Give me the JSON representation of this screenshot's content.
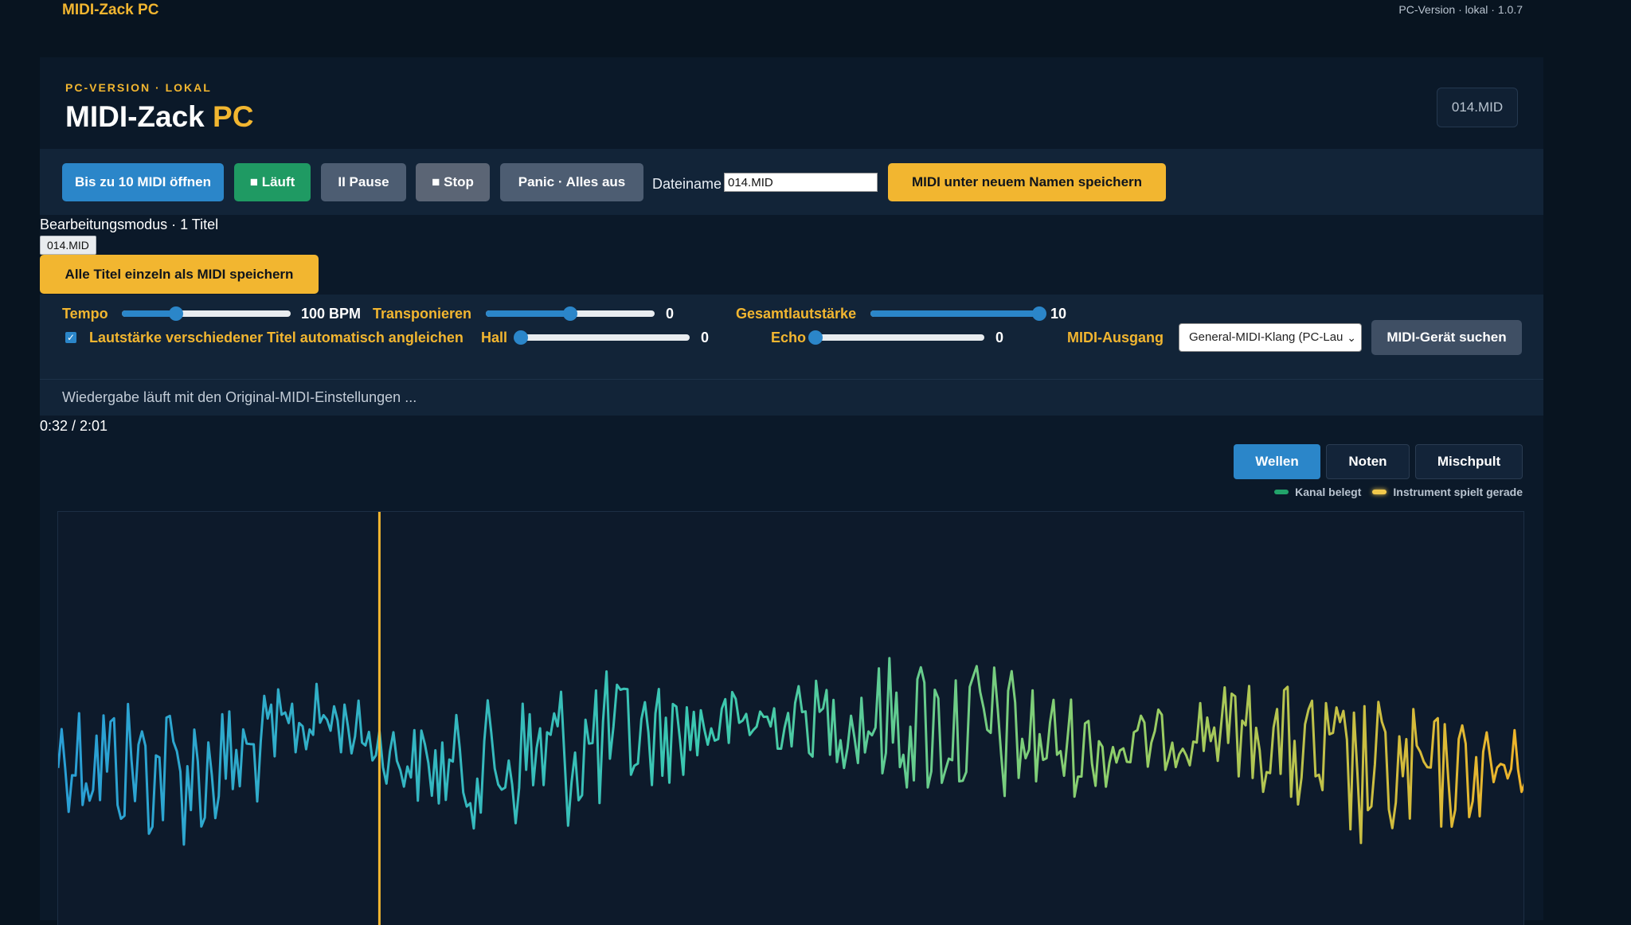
{
  "topbar": {
    "brand": "MIDI-Zack PC",
    "meta": "PC-Version · lokal · 1.0.7"
  },
  "header": {
    "kicker": "PC-VERSION · LOKAL",
    "title_main": "MIDI-Zack ",
    "title_accent": "PC",
    "file_badge": "014.MID"
  },
  "toolbar": {
    "open_label": "Bis zu 10 MIDI öffnen",
    "play_label": "■ Läuft",
    "pause_label": "II Pause",
    "stop_label": "■ Stop",
    "panic_label": "Panic · Alles aus",
    "filename_label": "Dateiname",
    "filename_value": "014.MID",
    "save_as_label": "MIDI unter neuem Namen speichern"
  },
  "edit": {
    "mode_text": "Bearbeitungsmodus · 1 Titel",
    "file_tag": "014.MID",
    "save_all_label": "Alle Titel einzeln als MIDI speichern"
  },
  "controls": {
    "tempo_label": "Tempo",
    "tempo_value": "100 BPM",
    "tempo_level": 0.32,
    "transpose_label": "Transponieren",
    "transpose_value": "0",
    "transpose_level": 0.5,
    "volume_label": "Gesamtlautstärke",
    "volume_value": "10",
    "volume_level": 1.0,
    "auto_level_checked": true,
    "auto_level_label": "Lautstärke verschiedener Titel automatisch angleichen",
    "reverb_label": "Hall",
    "reverb_value": "0",
    "reverb_level": 0.0,
    "echo_label": "Echo",
    "echo_value": "0",
    "echo_level": 0.0,
    "output_label": "MIDI-Ausgang",
    "output_selected": "General-MIDI-Klang (PC-Lau",
    "find_device_label": "MIDI-Gerät suchen"
  },
  "status": {
    "text": "Wiedergabe läuft mit den Original-MIDI-Einstellungen ...",
    "time": "0:32 / 2:01"
  },
  "views": {
    "tabs": [
      "Wellen",
      "Noten",
      "Mischpult"
    ],
    "active": "Wellen"
  },
  "legend": {
    "channel_used": "Kanal belegt",
    "instrument_playing": "Instrument spielt gerade",
    "channel_color": "#22a36a",
    "instrument_color": "#f2c94c"
  },
  "colors": {
    "accent": "#f2b630",
    "primary": "#2b86c9",
    "success": "#1f9a63",
    "wave_start": "#2a9fd6",
    "wave_mid": "#3cc9b0",
    "wave_end": "#f0b429",
    "playhead": "#f2b630"
  },
  "wave": {
    "playhead_fraction": 0.219
  }
}
